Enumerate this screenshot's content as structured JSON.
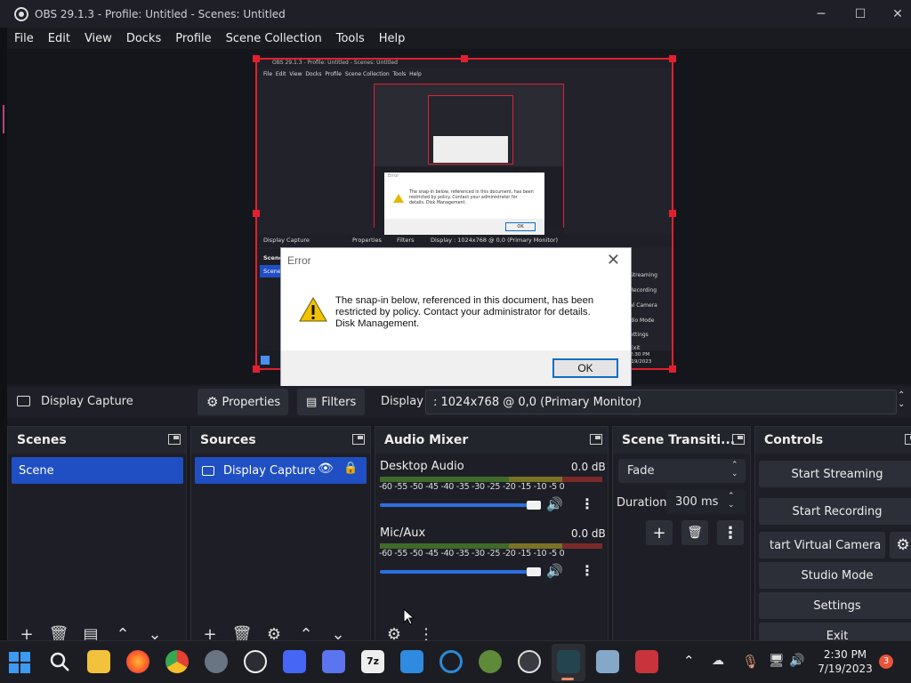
{
  "window": {
    "title": "OBS 29.1.3 - Profile: Untitled - Scenes: Untitled"
  },
  "menu": [
    "File",
    "Edit",
    "View",
    "Docks",
    "Profile",
    "Scene Collection",
    "Tools",
    "Help"
  ],
  "preview": {
    "inner_title": "OBS 29.1.3 - Profile: Untitled - Scenes: Untitled",
    "inner_menu": "File  Edit  View  Docks  Profile  Scene Collection  Tools  Help",
    "inner_source": "Display Capture",
    "inner_props": "Properties",
    "inner_filters": "Filters",
    "inner_display": "Display",
    "inner_display_value": ": 1024x768 @ 0,0 (Primary Monitor)",
    "inner_controls": [
      "Streaming",
      "Recording",
      "al Camera",
      "dio Mode",
      "ettings",
      "Exit"
    ],
    "inner_scene_hdr": "Scene",
    "inner_scene_item": "Scene",
    "inner_time": "2:30 PM",
    "inner_date": "7/19/2023",
    "inner_err_msg": "The snap-in below, referenced in this document, has been restricted by policy. Contact your administrator for details. Disk Management.",
    "inner_err_ok": "OK"
  },
  "error_dialog": {
    "title": "Error",
    "message": "The snap-in below, referenced in this document, has been\nrestricted by policy. Contact your administrator for details.\nDisk Management.",
    "ok_label": "OK"
  },
  "source_bar": {
    "source_name": "Display Capture",
    "properties_label": "Properties",
    "filters_label": "Filters",
    "display_label": "Display",
    "display_value": ": 1024x768 @ 0,0 (Primary Monitor)"
  },
  "docks": {
    "scenes": {
      "title": "Scenes",
      "items": [
        "Scene"
      ]
    },
    "sources": {
      "title": "Sources",
      "items": [
        "Display Capture"
      ]
    },
    "mixer": {
      "title": "Audio Mixer",
      "scale": [
        "-60",
        "-55",
        "-50",
        "-45",
        "-40",
        "-35",
        "-30",
        "-25",
        "-20",
        "-15",
        "-10",
        "-5",
        "0"
      ],
      "channels": [
        {
          "name": "Desktop Audio",
          "db": "0.0 dB",
          "volume": 0.96
        },
        {
          "name": "Mic/Aux",
          "db": "0.0 dB",
          "volume": 0.96
        }
      ]
    },
    "transitions": {
      "title": "Scene Transiti...",
      "type": "Fade",
      "duration_label": "Duration",
      "duration_value": "300 ms"
    },
    "controls": {
      "title": "Controls",
      "buttons": [
        "Start Streaming",
        "Start Recording",
        "tart Virtual Camera",
        "Studio Mode",
        "Settings",
        "Exit"
      ]
    }
  },
  "taskbar": {
    "time": "2:30 PM",
    "date": "7/19/2023",
    "notification_count": "3",
    "apps": [
      "windows-start",
      "search",
      "file-explorer",
      "firefox",
      "chrome",
      "settings",
      "obs",
      "app-w1",
      "app-w2",
      "7zip",
      "notepad",
      "edge-dev",
      "plant-app",
      "media-player",
      "obs-active",
      "photos",
      "cards-app"
    ]
  },
  "colors": {
    "accent": "#1f4fc2",
    "selection_red": "#e02030",
    "dock_bg": "#1e1f26"
  }
}
